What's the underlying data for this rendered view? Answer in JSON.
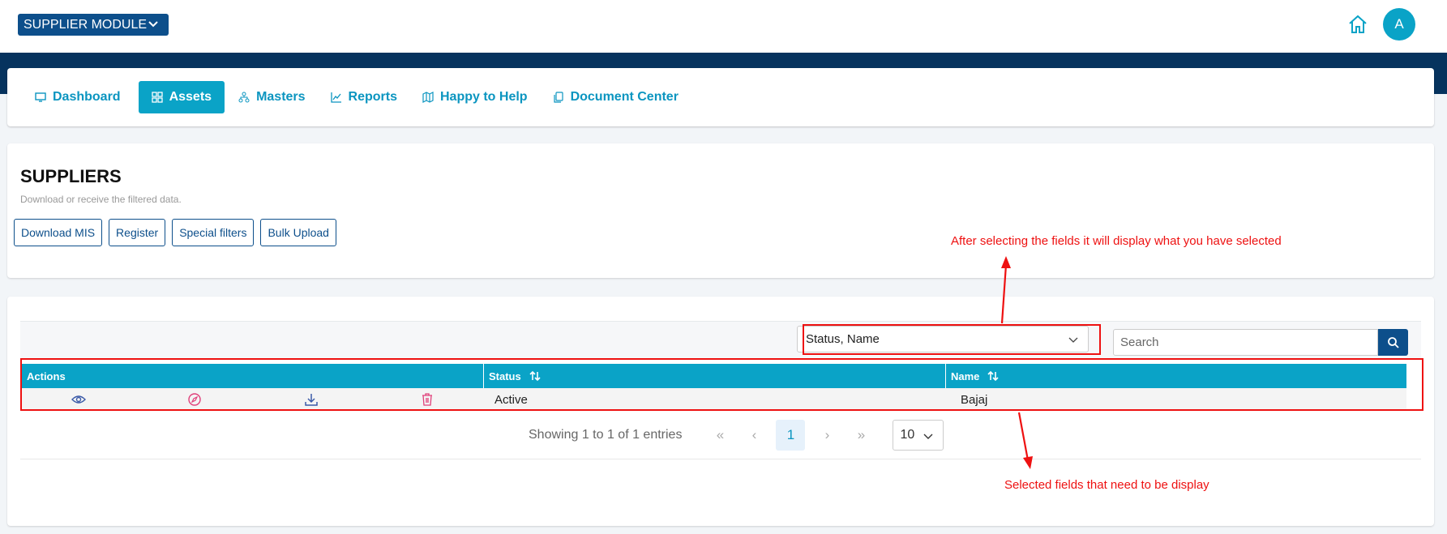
{
  "header": {
    "module_label": "SUPPLIER MODULE",
    "avatar_letter": "A"
  },
  "nav": {
    "items": [
      {
        "label": "Dashboard",
        "icon": "monitor-icon"
      },
      {
        "label": "Assets",
        "icon": "grid-icon",
        "active": true
      },
      {
        "label": "Masters",
        "icon": "hierarchy-icon"
      },
      {
        "label": "Reports",
        "icon": "chart-line-icon"
      },
      {
        "label": "Happy to Help",
        "icon": "map-icon"
      },
      {
        "label": "Document Center",
        "icon": "copy-icon"
      }
    ]
  },
  "suppliers": {
    "title": "SUPPLIERS",
    "subtitle": "Download or receive the filtered data.",
    "buttons": [
      "Download MIS",
      "Register",
      "Special filters",
      "Bulk Upload"
    ]
  },
  "filters": {
    "selected_fields": "Status, Name",
    "search_placeholder": "Search"
  },
  "table": {
    "columns": [
      "Actions",
      "Status",
      "Name"
    ],
    "rows": [
      {
        "status": "Active",
        "name": "Bajaj"
      }
    ],
    "action_icons": [
      "eye-icon",
      "compass-icon",
      "download-icon",
      "trash-icon"
    ]
  },
  "pagination": {
    "info": "Showing 1 to 1 of 1 entries",
    "first": "«",
    "prev": "‹",
    "current_page": "1",
    "next": "›",
    "last": "»",
    "page_size": "10"
  },
  "annotations": {
    "top_note": "After selecting the fields it will display what you have selected",
    "bottom_note": "Selected fields that need to be display",
    "color": "#ee1111"
  },
  "colors": {
    "primary": "#0d4f8b",
    "accent": "#0aa3c7",
    "navbar_dark": "#06335e"
  }
}
